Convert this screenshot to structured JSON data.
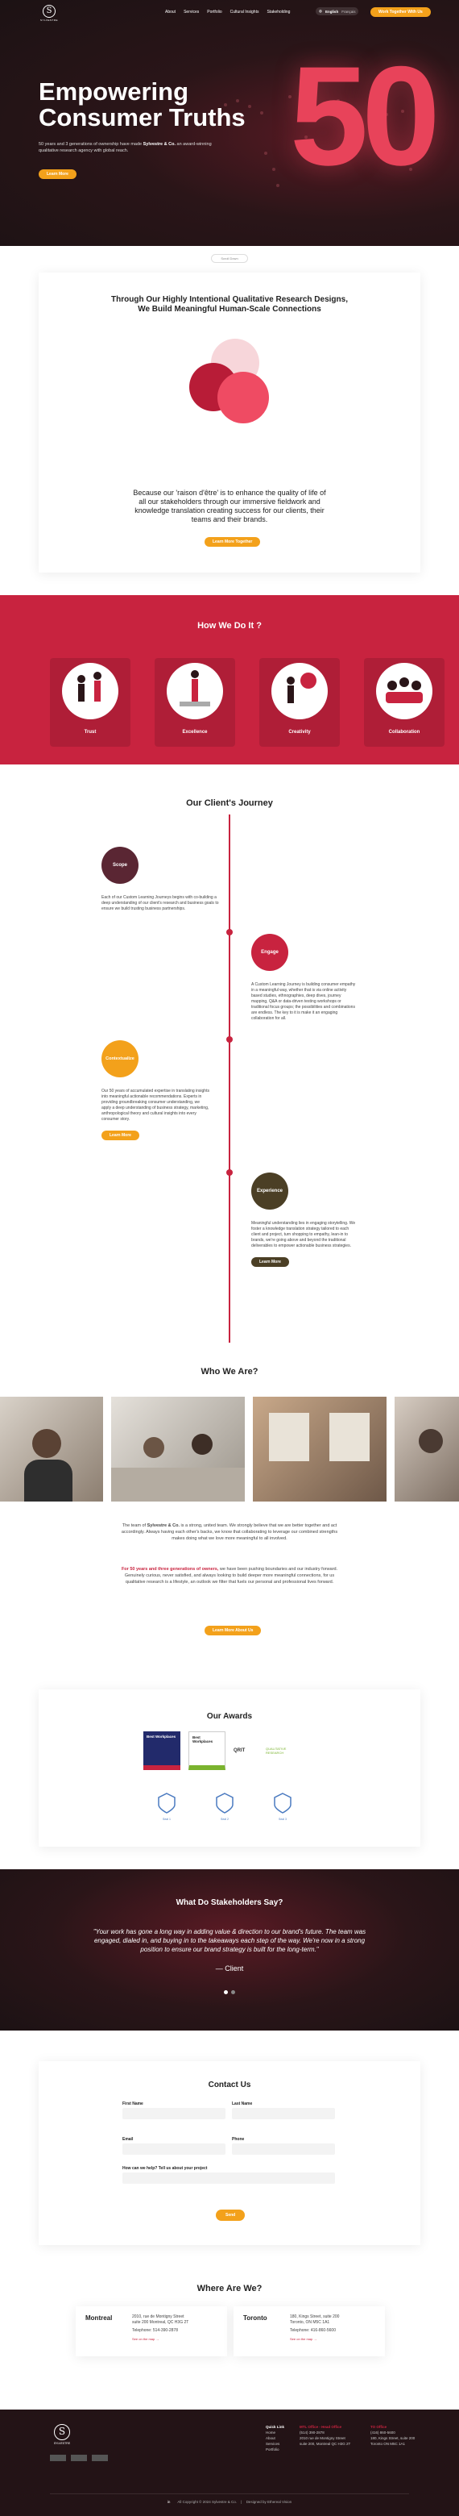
{
  "nav": {
    "logo_letter": "S",
    "logo_text": "SYLVESTRE",
    "items": [
      "About",
      "Services",
      "Portfolio",
      "Cultural Insights",
      "Stakeholding"
    ],
    "lang": [
      "English",
      "Français"
    ],
    "cta": "Work Together With Us"
  },
  "hero": {
    "title_line1": "Empowering",
    "title_line2": "Consumer Truths",
    "subtitle_pre": "50 years and 3 generations of ownership have made ",
    "subtitle_brand": "Sylvestre & Co.",
    "subtitle_post": " an award-winning qualitative research agency with global reach.",
    "cta": "Learn More",
    "big_number": "50",
    "scroll_label": "Scroll Down"
  },
  "intro": {
    "title_line1": "Through Our Highly Intentional Qualitative Research Designs,",
    "title_line2": "We Build Meaningful Human-Scale Connections",
    "text": "Because our 'raison d'être' is to enhance the quality of life of all our stakeholders through our immersive fieldwork and knowledge translation creating success for our clients, their teams and their brands.",
    "cta": "Learn More Together"
  },
  "how": {
    "title": "How We Do It ?",
    "items": [
      "Trust",
      "Excellence",
      "Creativity",
      "Collaboration"
    ]
  },
  "journey": {
    "title": "Our Client's Journey",
    "steps": [
      {
        "label": "Scope",
        "color": "#5a2633",
        "text": "Each of our Custom Learning Journeys begins with co-building a deep understanding of our client's research and business goals to ensure we build trusting business partnerships."
      },
      {
        "label": "Engage",
        "color": "#c8233f",
        "text": "A Custom Learning Journey is building consumer empathy in a meaningful way, whether that is via online activity based studies, ethnographies, deep dives, journey mapping, Q&A or data-driven testing workshops or traditional focus groups; the possibilities and combinations are endless. The key to it is make it an engaging collaboration for all."
      },
      {
        "label": "Contextualize",
        "color": "#f3a11b",
        "text": "Our 50 years of accumulated expertise in translating insights into meaningful actionable recommendations. Experts in providing groundbreaking consumer understanding, we apply a deep understanding of business strategy, marketing, anthropological theory and cultural insights into every consumer story.",
        "cta": "Learn More"
      },
      {
        "label": "Experience",
        "color": "#4b3f25",
        "text": "Meaningful understanding lies in engaging storytelling. We foster a knowledge translation strategy tailored to each client and project, turn shopping to empathy, lean-in to brands, we're going above and beyond the traditional deliverables to empower actionable business strategies.",
        "cta": "Learn More"
      }
    ]
  },
  "who": {
    "title": "Who We Are?",
    "p1_pre": "The team of ",
    "p1_brand": "Sylvestre & Co.",
    "p1_post": " is a strong, united team. We strongly believe that we are better together and act accordingly. Always having each other's backs, we know that collaborating to leverage our combined strengths makes doing what we love more meaningful to all involved.",
    "p2_accent": "For 50 years and three generations of owners,",
    "p2_post": " we have been pushing boundaries and our industry forward. Genuinely curious, never satisfied, and always looking to build deeper more meaningful connections, for us qualitative research is a lifestyle, an outlook we filter that fuels our personal and professional lives forward.",
    "cta": "Learn More About Us"
  },
  "awards": {
    "title": "Our Awards",
    "badges": [
      "Best Workplaces",
      "Best Workplaces",
      "QRIT",
      "QUALITATIVE RESEARCH"
    ],
    "seals": [
      "Seal 1",
      "Seal 2",
      "Seal 3"
    ]
  },
  "testimonial": {
    "title": "What Do Stakeholders Say?",
    "quote": "\"Your work has gone a long way in adding value & direction to our brand's future. The team was engaged, dialed in, and buying in to the takeaways each step of the way. We're now in a strong position to ensure our brand strategy is built for the long-term.\"",
    "author": "Client"
  },
  "contact": {
    "title": "Contact Us",
    "first_name_label": "First Name",
    "last_name_label": "Last Name",
    "email_label": "Email",
    "phone_label": "Phone",
    "help_label": "How can we help? Tell us about your project",
    "cta": "Send"
  },
  "where": {
    "title": "Where Are We?",
    "offices": [
      {
        "city": "Montreal",
        "line1": "2010, rue de Montigny Street",
        "line2": "suite 200 Montreal, QC H3G 2T",
        "phone": "Telephone: 514-390-2878",
        "link": "See on the map →"
      },
      {
        "city": "Toronto",
        "line1": "180, Kings Street, suite 200",
        "line2": "Toronto, ON M5C 1A1",
        "phone": "Telephone: 416-860-5600",
        "link": "See on the map →"
      }
    ]
  },
  "footer": {
    "logo_letter": "S",
    "logo_text": "SYLVESTRE",
    "col1_title": "Quick Link",
    "col1_items": [
      "Home",
      "About",
      "Services",
      "Portfolio"
    ],
    "col2_title": "MTL Office - Head Office",
    "col2_items": [
      "(514) 390-2878",
      "2010 rue de Montigny Street",
      "suite 200, Montreal QC H3G 2T"
    ],
    "col3_title": "TO Office",
    "col3_items": [
      "(416) 860-5600",
      "180, Kings Street, suite 200",
      "Toronto ON M5C 1A1"
    ],
    "copyright": "All Copyright © 2024 Sylvestre & Co.",
    "credit": "Designed by Ethereal Vision"
  },
  "colors": {
    "accent": "#f3a11b",
    "brand_red": "#c8233f",
    "dark": "#2a1518"
  }
}
